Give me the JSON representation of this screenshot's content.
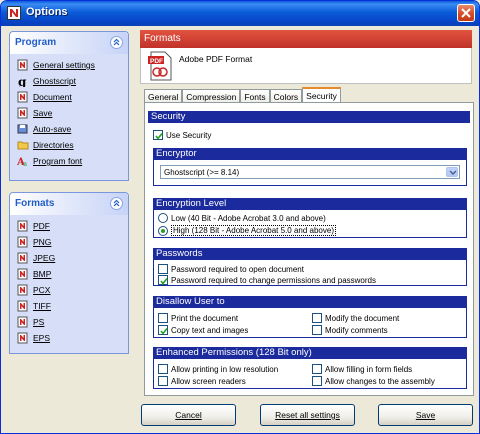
{
  "window": {
    "title": "Options"
  },
  "program_panel": {
    "title": "Program",
    "items": [
      {
        "label": "General settings",
        "icon": "settings-icon"
      },
      {
        "label": "Ghostscript",
        "icon": "ghostscript-icon"
      },
      {
        "label": "Document",
        "icon": "document-icon"
      },
      {
        "label": "Save",
        "icon": "save-icon"
      },
      {
        "label": "Auto-save",
        "icon": "autosave-icon"
      },
      {
        "label": "Directories",
        "icon": "folder-icon"
      },
      {
        "label": "Program font",
        "icon": "font-icon"
      }
    ]
  },
  "formats_panel": {
    "title": "Formats",
    "items": [
      {
        "label": "PDF"
      },
      {
        "label": "PNG"
      },
      {
        "label": "JPEG"
      },
      {
        "label": "BMP"
      },
      {
        "label": "PCX"
      },
      {
        "label": "TIFF"
      },
      {
        "label": "PS"
      },
      {
        "label": "EPS"
      }
    ]
  },
  "formats_header": "Formats",
  "format_name": "Adobe PDF Format",
  "pdf_icon_text": "PDF",
  "tabs": [
    {
      "label": "General",
      "active": false
    },
    {
      "label": "Compression",
      "active": false
    },
    {
      "label": "Fonts",
      "active": false
    },
    {
      "label": "Colors",
      "active": false
    },
    {
      "label": "Security",
      "active": true
    }
  ],
  "security": {
    "header": "Security",
    "use_security": {
      "label": "Use Security",
      "checked": true
    },
    "encryptor": {
      "header": "Encryptor",
      "value": "Ghostscript (>= 8.14)"
    },
    "encryption_level": {
      "header": "Encryption Level",
      "low": {
        "label": "Low (40 Bit - Adobe Acrobat 3.0 and above)",
        "selected": false
      },
      "high": {
        "label": "High (128 Bit - Adobe Acrobat 5.0 and above)",
        "selected": true
      }
    },
    "passwords": {
      "header": "Passwords",
      "open": {
        "label": "Password required to open document",
        "checked": false
      },
      "change": {
        "label": "Password required to change permissions and passwords",
        "checked": true
      }
    },
    "disallow": {
      "header": "Disallow User to",
      "print": {
        "label": "Print the document",
        "checked": false
      },
      "modify": {
        "label": "Modify the document",
        "checked": false
      },
      "copy": {
        "label": "Copy text and images",
        "checked": true
      },
      "comments": {
        "label": "Modify comments",
        "checked": false
      }
    },
    "enhanced": {
      "header": "Enhanced Permissions (128 Bit only)",
      "low_res": {
        "label": "Allow printing in low resolution",
        "checked": false
      },
      "fill_forms": {
        "label": "Allow filling in form fields",
        "checked": false
      },
      "screen_readers": {
        "label": "Allow screen readers",
        "checked": false
      },
      "assembly": {
        "label": "Allow changes to the assembly",
        "checked": false
      }
    }
  },
  "buttons": {
    "cancel": "Cancel",
    "reset": "Reset all settings",
    "save": "Save"
  },
  "colors": {
    "accent": "#1b2a9c",
    "header_red": "#c0322a",
    "titlebar": "#0a5bd8"
  }
}
